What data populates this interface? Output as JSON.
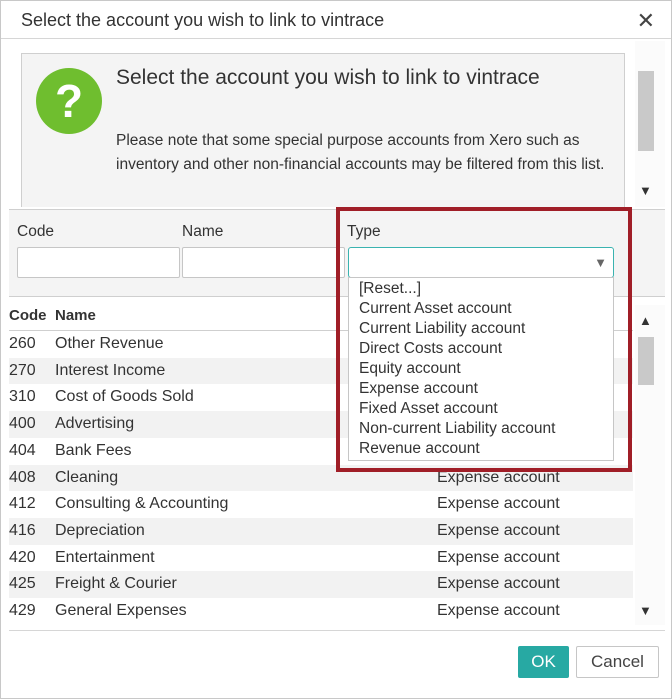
{
  "dialog": {
    "title": "Select the account you wish to link to vintrace",
    "close_glyph": "✕"
  },
  "info": {
    "icon": "question-icon",
    "icon_glyph": "?",
    "icon_color": "#6fbe2f",
    "heading": "Select the account you wish to link to vintrace",
    "text": "Please note that some special purpose accounts from Xero such as inventory and other non-financial accounts may be filtered from this list."
  },
  "filters": {
    "code_label": "Code",
    "name_label": "Name",
    "type_label": "Type",
    "code_value": "",
    "name_value": "",
    "type_value": ""
  },
  "type_options": [
    "[Reset...]",
    "Current Asset account",
    "Current Liability account",
    "Direct Costs account",
    "Equity account",
    "Expense account",
    "Fixed Asset account",
    "Non-current Liability account",
    "Revenue account"
  ],
  "table": {
    "headers": {
      "code": "Code",
      "name": "Name"
    },
    "rows": [
      {
        "code": "260",
        "name": "Other Revenue",
        "type": ""
      },
      {
        "code": "270",
        "name": "Interest Income",
        "type": ""
      },
      {
        "code": "310",
        "name": "Cost of Goods Sold",
        "type": ""
      },
      {
        "code": "400",
        "name": "Advertising",
        "type": ""
      },
      {
        "code": "404",
        "name": "Bank Fees",
        "type": ""
      },
      {
        "code": "408",
        "name": "Cleaning",
        "type": "Expense account"
      },
      {
        "code": "412",
        "name": "Consulting & Accounting",
        "type": "Expense account"
      },
      {
        "code": "416",
        "name": "Depreciation",
        "type": "Expense account"
      },
      {
        "code": "420",
        "name": "Entertainment",
        "type": "Expense account"
      },
      {
        "code": "425",
        "name": "Freight & Courier",
        "type": "Expense account"
      },
      {
        "code": "429",
        "name": "General Expenses",
        "type": "Expense account"
      }
    ]
  },
  "footer": {
    "ok_label": "OK",
    "cancel_label": "Cancel"
  },
  "colors": {
    "accent": "#27a9a3",
    "highlight": "#a01e27"
  }
}
